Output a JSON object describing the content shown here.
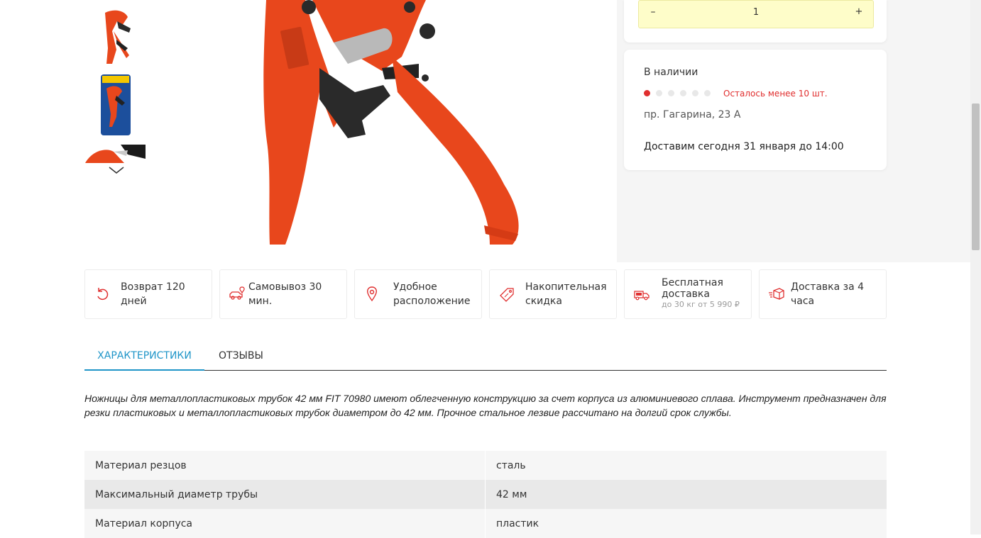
{
  "quantity": {
    "minus": "–",
    "value": "1",
    "plus": "+"
  },
  "stock": {
    "title": "В наличии",
    "level_filled": 1,
    "level_total": 6,
    "note": "Осталось менее 10 шт.",
    "address": "пр. Гагарина, 23 А",
    "delivery": "Доставим сегодня 31 января до 14:00"
  },
  "benefits": [
    {
      "label": "Возврат 120 дней",
      "icon": "return-icon"
    },
    {
      "label": "Самовывоз 30 мин.",
      "icon": "car-pickup-icon"
    },
    {
      "label": "Удобное расположение",
      "icon": "location-pin-icon"
    },
    {
      "label": "Накопительная скидка",
      "icon": "discount-tag-icon"
    },
    {
      "label": "Бесплатная доставка",
      "sub": "до 30 кг от 5 990 ₽",
      "icon": "free-delivery-truck-icon"
    },
    {
      "label": "Доставка за 4 часа",
      "icon": "delivery-box-icon"
    }
  ],
  "tabs": [
    {
      "label": "ХАРАКТЕРИСТИКИ"
    },
    {
      "label": "ОТЗЫВЫ"
    }
  ],
  "description": "Ножницы для металлопластиковых трубок 42 мм FIT 70980 имеют облегченную конструкцию за счет корпуса из алюминиевого сплава. Инструмент предназначен для резки пластиковых и металлопластиковых трубок диаметром до 42 мм. Прочное стальное лезвие рассчитано на долгий срок службы.",
  "specs": [
    {
      "key": "Материал резцов",
      "value": "сталь"
    },
    {
      "key": "Максимальный диаметр трубы",
      "value": "42 мм"
    },
    {
      "key": "Материал корпуса",
      "value": "пластик"
    }
  ],
  "colors": {
    "accent": "#1f95c8",
    "stock_red": "#e02f2f",
    "qty_bg": "#fefdc9",
    "tool_red": "#e8471c"
  }
}
